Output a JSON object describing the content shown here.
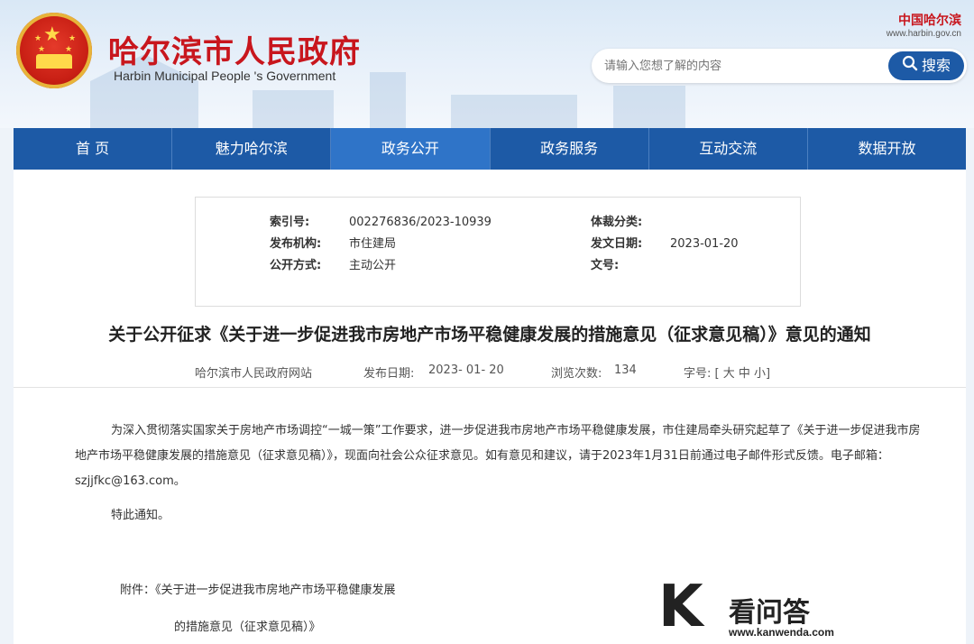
{
  "header": {
    "title_cn": "哈尔滨市人民政府",
    "title_en": "Harbin Municipal People 's Government",
    "brand_cn": "中国哈尔滨",
    "brand_url": "www.harbin.gov.cn",
    "search_placeholder": "请输入您想了解的内容",
    "search_label": "搜索"
  },
  "nav": {
    "items": [
      "首 页",
      "魅力哈尔滨",
      "政务公开",
      "政务服务",
      "互动交流",
      "数据开放"
    ],
    "active": "政务公开"
  },
  "meta": {
    "index_no_label": "索引号:",
    "index_no": "002276836/2023-10939",
    "genre_label": "体裁分类:",
    "genre": "",
    "publisher_label": "发布机构:",
    "publisher": "市住建局",
    "date_label": "发文日期:",
    "date": "2023-01-20",
    "method_label": "公开方式:",
    "method": "主动公开",
    "doc_no_label": "文号:",
    "doc_no": ""
  },
  "article": {
    "title": "关于公开征求《关于进一步促进我市房地产市场平稳健康发展的措施意见（征求意见稿）》意见的通知",
    "source": "哈尔滨市人民政府网站",
    "publish_label": "发布日期:",
    "publish_date": "2023- 01- 20",
    "views_label": "浏览次数:",
    "views": "134",
    "fontsize_text": "字号: [ 大 中 小]",
    "body": "为深入贯彻落实国家关于房地产市场调控“一城一策”工作要求，进一步促进我市房地产市场平稳健康发展，市住建局牵头研究起草了《关于进一步促进我市房地产市场平稳健康发展的措施意见（征求意见稿）》，现面向社会公众征求意见。如有意见和建议，请于2023年1月31日前通过电子邮件形式反馈。电子邮箱：szjjfkc@163.com。",
    "closing": "特此通知。",
    "attachment_line1": "附件：《关于进一步促进我市房地产市场平稳健康发展",
    "attachment_line2": "的措施意见（征求意见稿）》"
  },
  "watermark": {
    "cn": "看问答",
    "url": "www.kanwenda.com"
  },
  "colors": {
    "nav_bg": "#1d5aa6",
    "nav_active": "#2f74c8",
    "title_red": "#c8161d"
  }
}
